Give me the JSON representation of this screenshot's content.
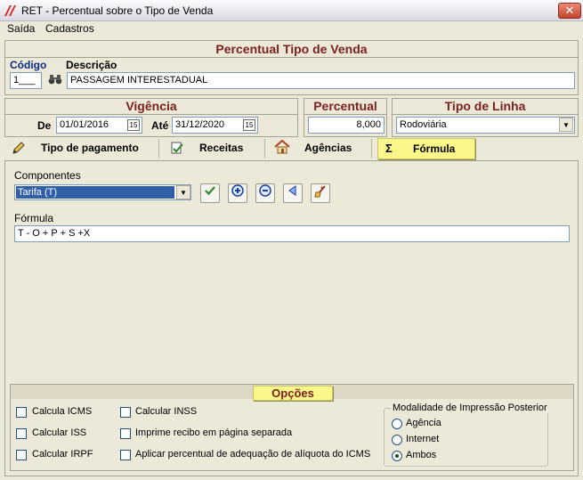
{
  "window": {
    "title": "RET - Percentual sobre o Tipo de Venda",
    "close_glyph": "✕"
  },
  "menu": [
    "Saída",
    "Cadastros"
  ],
  "header": {
    "title": "Percentual Tipo de Venda",
    "codigo_label": "Código",
    "descricao_label": "Descrição",
    "codigo_value": "1___",
    "descricao_value": "PASSAGEM INTERESTADUAL"
  },
  "vigencia": {
    "title": "Vigência",
    "de_label": "De",
    "de_value": "01/01/2016",
    "ate_label": "Até",
    "ate_value": "31/12/2020",
    "cal_glyph": "15"
  },
  "percentual": {
    "title": "Percentual",
    "value": "8,000"
  },
  "tipo_linha": {
    "title": "Tipo de Linha",
    "value": "Rodoviária"
  },
  "tabs": [
    {
      "label": "Tipo de pagamento",
      "icon": "pencil-icon"
    },
    {
      "label": "Receitas",
      "icon": "checklist-icon"
    },
    {
      "label": "Agências",
      "icon": "house-icon"
    },
    {
      "label": "Fórmula",
      "icon": "sigma-icon",
      "glyph": "Σ",
      "active": true
    }
  ],
  "formula_tab": {
    "componentes_label": "Componentes",
    "componente_selected": "Tarifa (T)",
    "formula_label": "Fórmula",
    "formula_value": "T - O + P + S +X"
  },
  "opcoes": {
    "title": "Opções",
    "checkboxes": [
      "Calcula ICMS",
      "Calcular ISS",
      "Calcular IRPF",
      "Calcular INSS",
      "Imprime recibo em página separada",
      "Aplicar percentual de adequação de alíquota do ICMS"
    ],
    "modalidade": {
      "title": "Modalidade de Impressão Posterior",
      "options": [
        "Agência",
        "Internet",
        "Ambos"
      ],
      "selected": "Ambos"
    }
  },
  "colors": {
    "heading": "#7b1f1f",
    "label_blue": "#0b2a8a",
    "active_tab": "#faf78a"
  }
}
